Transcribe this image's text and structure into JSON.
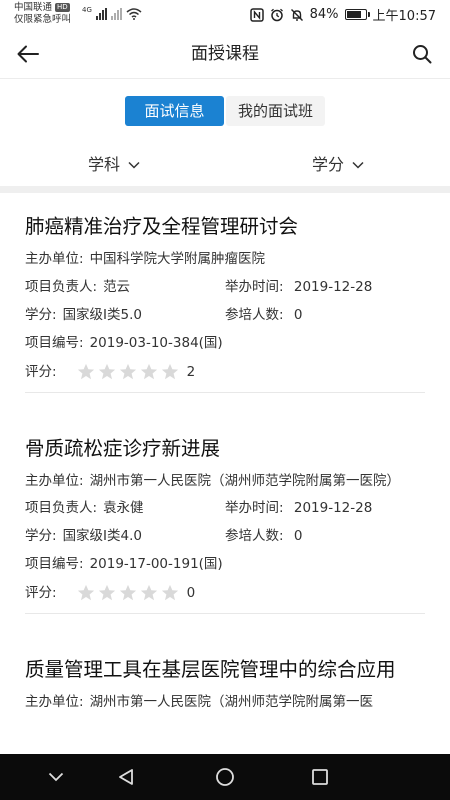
{
  "status_bar": {
    "carrier": "中国联通",
    "hd_badge": "HD",
    "emergency": "仅限紧急呼叫",
    "net_4g": "4G",
    "battery": "84%",
    "battery_level": 0.84,
    "time": "上午10:57"
  },
  "nav": {
    "title": "面授课程"
  },
  "tabs": {
    "active": "面试信息",
    "inactive": "我的面试班"
  },
  "filters": {
    "subject": "学科",
    "credit": "学分"
  },
  "labels": {
    "organizer": "主办单位:",
    "leader": "项目负责人:",
    "date": "举办时间:",
    "credit": "学分:",
    "attendees": "参培人数:",
    "code": "项目编号:",
    "rating": "评分:"
  },
  "courses": [
    {
      "title": "肺癌精准治疗及全程管理研讨会",
      "organizer": "中国科学院大学附属肿瘤医院",
      "leader": "范云",
      "date": "2019-12-28",
      "credit": "国家级I类5.0",
      "attendees": "0",
      "code": "2019-03-10-384(国)",
      "rating_count": "2"
    },
    {
      "title": "骨质疏松症诊疗新进展",
      "organizer": "湖州市第一人民医院（湖州师范学院附属第一医院）",
      "leader": "袁永健",
      "date": "2019-12-28",
      "credit": "国家级I类4.0",
      "attendees": "0",
      "code": "2019-17-00-191(国)",
      "rating_count": "0"
    },
    {
      "title": "质量管理工具在基层医院管理中的综合应用",
      "organizer": "湖州市第一人民医院（湖州师范学院附属第一医"
    }
  ],
  "colors": {
    "accent": "#1b82d2",
    "star": "#d9d9d9",
    "system_nav": "#0b0b0b"
  }
}
